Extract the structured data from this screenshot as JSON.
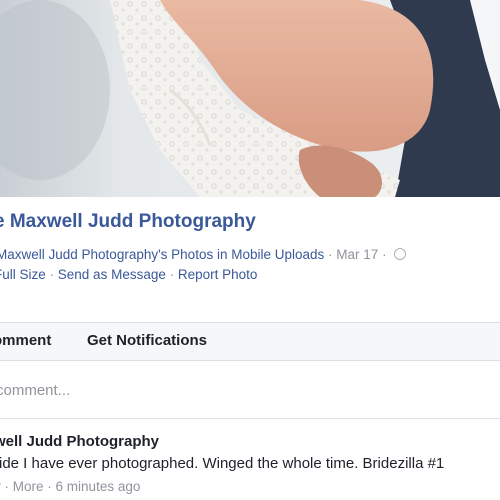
{
  "post": {
    "page_name": "e Maxwell Judd Photography",
    "album_link": "Maxwell Judd Photography's Photos in Mobile Uploads",
    "date": "Mar 17",
    "photo_actions": [
      "Full Size",
      "Send as Message",
      "Report Photo"
    ]
  },
  "action_bar": {
    "comment_label": "omment",
    "notifications_label": "Get Notifications"
  },
  "comment_box": {
    "placeholder": "comment..."
  },
  "comment": {
    "author": "well Judd Photography",
    "text": "ride I have ever photographed. Winged the whole time. Bridezilla #1",
    "meta_left": "y",
    "more_label": "More",
    "time": "6 minutes ago"
  },
  "colors": {
    "link_blue": "#3b5998",
    "text_dark": "#1d2129",
    "meta_gray": "#90949c"
  },
  "icons": {
    "privacy": "globe-icon"
  }
}
